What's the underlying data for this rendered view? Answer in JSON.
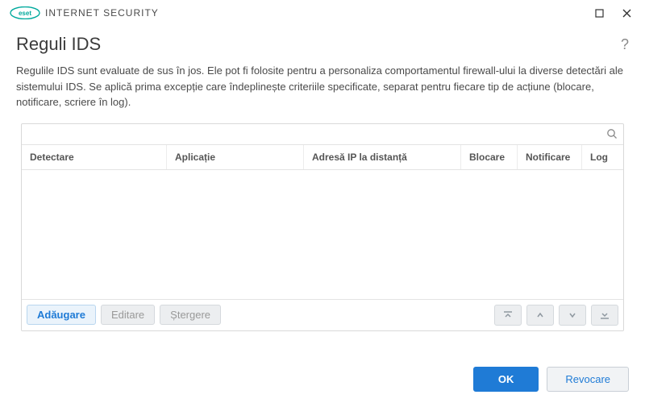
{
  "brand": {
    "name": "INTERNET SECURITY",
    "logo_label": "eset"
  },
  "window": {
    "minimize": "minimize",
    "close": "close"
  },
  "page": {
    "title": "Reguli IDS",
    "help": "?",
    "description": "Regulile IDS sunt evaluate de sus în jos. Ele pot fi folosite pentru a personaliza comportamentul firewall-ului la diverse detectări ale sistemului IDS. Se aplică prima excepție care îndeplinește criteriile specificate, separat pentru fiecare tip de acțiune (blocare, notificare, scriere în log)."
  },
  "search": {
    "placeholder": ""
  },
  "columns": {
    "detect": "Detectare",
    "app": "Aplicație",
    "addr": "Adresă IP la distanță",
    "block": "Blocare",
    "notif": "Notificare",
    "log": "Log"
  },
  "rows": [],
  "footer": {
    "add": "Adăugare",
    "edit": "Editare",
    "delete": "Ștergere"
  },
  "dialog": {
    "ok": "OK",
    "cancel": "Revocare"
  }
}
